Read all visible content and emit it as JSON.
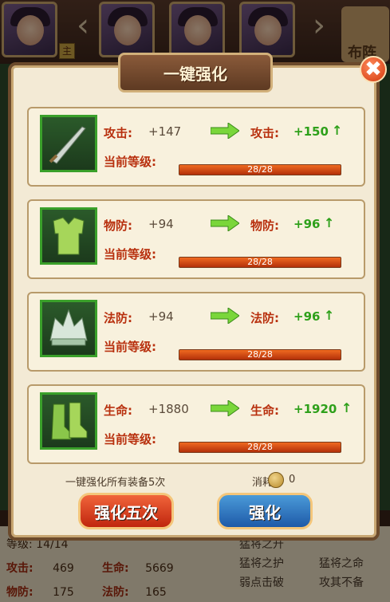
{
  "header": {
    "badge": "主",
    "formation_label": "布阵"
  },
  "modal": {
    "title": "一键强化",
    "close_glyph": "✖",
    "items": [
      {
        "stat": "攻击:",
        "current": "+147",
        "next": "+150",
        "level_label": "当前等级:",
        "level": "28/28",
        "icon": "sword-icon",
        "progress": 1.0
      },
      {
        "stat": "物防:",
        "current": "+94",
        "next": "+96",
        "level_label": "当前等级:",
        "level": "28/28",
        "icon": "armor-icon",
        "progress": 1.0
      },
      {
        "stat": "法防:",
        "current": "+94",
        "next": "+96",
        "level_label": "当前等级:",
        "level": "28/28",
        "icon": "helmet-icon",
        "progress": 1.0
      },
      {
        "stat": "生命:",
        "current": "+1880",
        "next": "+1920",
        "level_label": "当前等级:",
        "level": "28/28",
        "icon": "boots-icon",
        "progress": 1.0
      }
    ],
    "up_glyph": "↑",
    "note": "一键强化所有装备5次",
    "cost_label": "消耗:",
    "cost_value": "0",
    "btn_five": "强化五次",
    "btn_once": "强化"
  },
  "bottom": {
    "level_row": "等级:  14/14",
    "atk_label": "攻击:",
    "atk_value": "469",
    "hp_label": "生命:",
    "hp_value": "5669",
    "pdef_label": "物防:",
    "pdef_value": "175",
    "mdef_label": "法防:",
    "mdef_value": "165",
    "skills": [
      "猛将之升",
      "猛将之护",
      "猛将之命",
      "弱点击破",
      "攻其不备"
    ]
  },
  "colors": {
    "accent_red": "#b8300e",
    "accent_green": "#2ea01a",
    "bar": "#f06a20"
  }
}
